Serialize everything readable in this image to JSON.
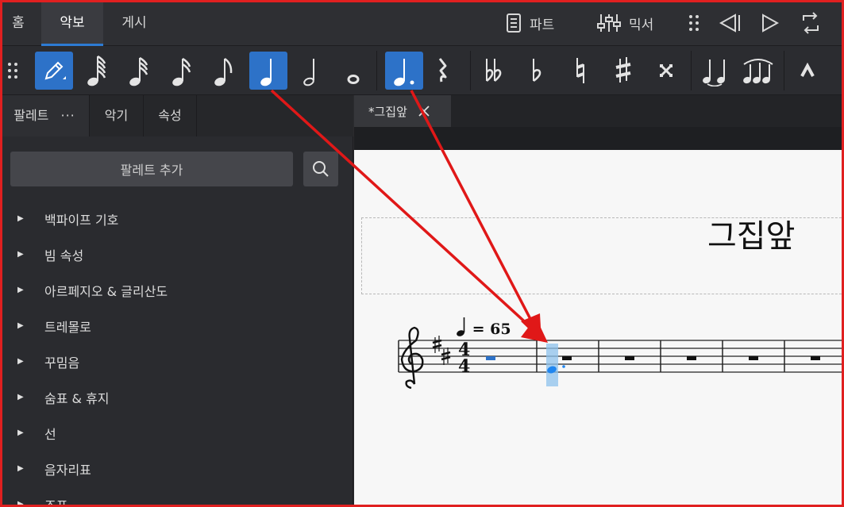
{
  "topbar": {
    "tabs": [
      "홈",
      "악보",
      "게시"
    ],
    "parts_label": "파트",
    "mixer_label": "믹서"
  },
  "toolbar": {
    "buttons": [
      "note-input",
      "64th",
      "32nd",
      "16th",
      "8th",
      "quarter",
      "half",
      "whole",
      "augmentation-dot",
      "rest",
      "double-flat",
      "flat",
      "natural",
      "sharp",
      "double-sharp",
      "tie",
      "slur",
      "marcato"
    ]
  },
  "panel": {
    "tabs": [
      "팔레트",
      "악기",
      "속성"
    ],
    "more": "···",
    "add_palette": "팔레트 추가",
    "items": [
      "백파이프 기호",
      "빔 속성",
      "아르페지오 & 글리산도",
      "트레몰로",
      "꾸밈음",
      "숨표 & 휴지",
      "선",
      "음자리표",
      "조표"
    ]
  },
  "document": {
    "tab_label": "*그집앞",
    "title": "그집앞",
    "tempo_value": "= 65"
  },
  "colors": {
    "accent": "#2d72c8",
    "arrow": "#e01818",
    "selection": "#8ec1ec"
  }
}
